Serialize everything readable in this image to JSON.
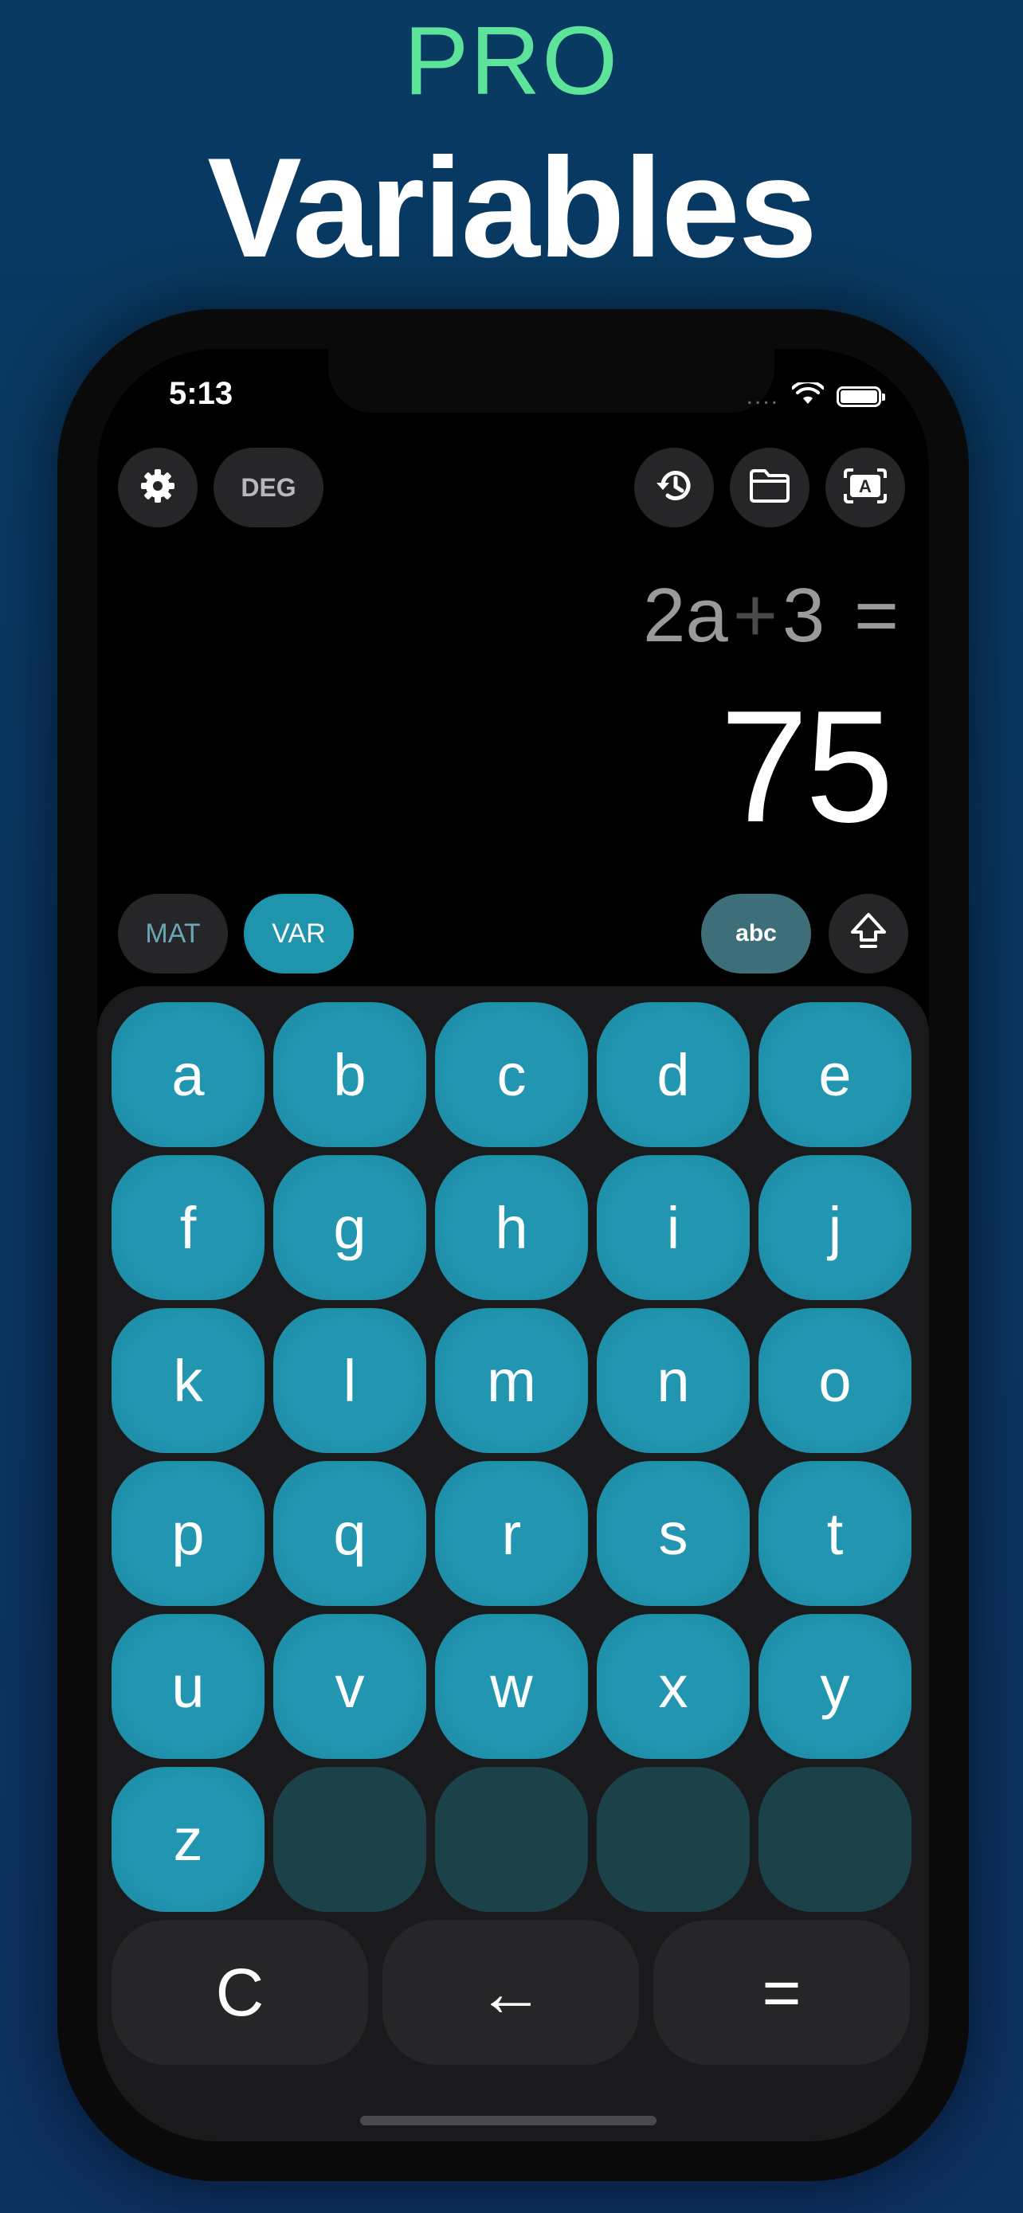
{
  "promo": {
    "pro": "PRO",
    "title": "Variables"
  },
  "status_bar": {
    "time": "5:13",
    "signal": "....",
    "wifi_icon": "wifi-icon",
    "battery_icon": "battery-icon"
  },
  "toolbar": {
    "settings_icon": "gear-icon",
    "angle_mode": "DEG",
    "history_icon": "history-icon",
    "folder_icon": "folder-icon",
    "variables_icon": "variable-screen-icon"
  },
  "display": {
    "expression": {
      "left": "2a",
      "op": "+",
      "right": "3",
      "equals": "="
    },
    "result": "75"
  },
  "mode_bar": {
    "mat": "MAT",
    "var": "VAR",
    "abc": "abc",
    "shift_icon": "shift-icon"
  },
  "keypad": {
    "keys": [
      "a",
      "b",
      "c",
      "d",
      "e",
      "f",
      "g",
      "h",
      "i",
      "j",
      "k",
      "l",
      "m",
      "n",
      "o",
      "p",
      "q",
      "r",
      "s",
      "t",
      "u",
      "v",
      "w",
      "x",
      "y",
      "z"
    ],
    "empty_slots": 4,
    "clear": "C",
    "backspace": "←",
    "equals": "="
  },
  "colors": {
    "accent_green": "#5ee39a",
    "key_teal": "#2296b1",
    "var_active": "#1f94ad",
    "abc_button": "#3e6e78",
    "background": "#083a62"
  }
}
